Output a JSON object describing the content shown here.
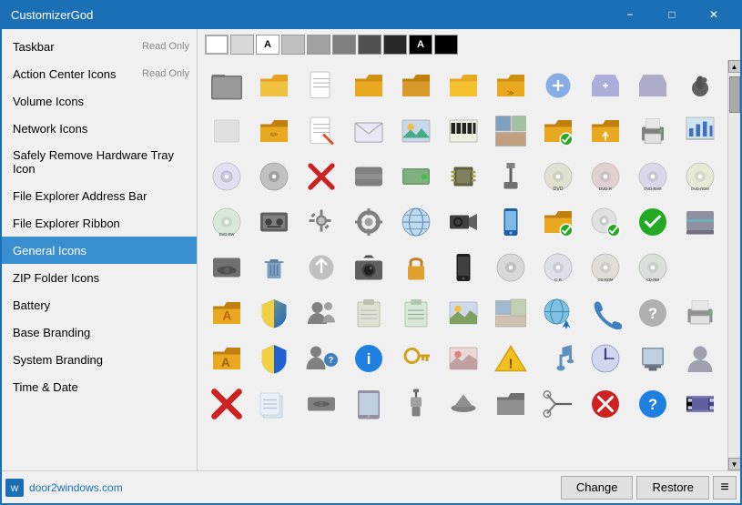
{
  "app": {
    "title": "CustomizerGod",
    "min_label": "−",
    "max_label": "□",
    "close_label": "✕"
  },
  "sidebar": {
    "items": [
      {
        "id": "taskbar",
        "label": "Taskbar",
        "badge": "Read Only"
      },
      {
        "id": "action-center",
        "label": "Action Center Icons",
        "badge": "Read Only"
      },
      {
        "id": "volume",
        "label": "Volume Icons",
        "badge": ""
      },
      {
        "id": "network",
        "label": "Network Icons",
        "badge": ""
      },
      {
        "id": "safely-remove",
        "label": "Safely Remove Hardware Tray Icon",
        "badge": ""
      },
      {
        "id": "file-explorer-addr",
        "label": "File Explorer Address Bar",
        "badge": ""
      },
      {
        "id": "file-explorer-ribbon",
        "label": "File Explorer Ribbon",
        "badge": ""
      },
      {
        "id": "general-icons",
        "label": "General Icons",
        "badge": ""
      },
      {
        "id": "zip-folder",
        "label": "ZIP Folder Icons",
        "badge": ""
      },
      {
        "id": "battery",
        "label": "Battery",
        "badge": ""
      },
      {
        "id": "base-branding",
        "label": "Base Branding",
        "badge": ""
      },
      {
        "id": "system-branding",
        "label": "System Branding",
        "badge": ""
      },
      {
        "id": "time-date",
        "label": "Time & Date",
        "badge": ""
      }
    ]
  },
  "swatches": [
    {
      "color": "#ffffff",
      "label": ""
    },
    {
      "color": "#d0d0d0",
      "label": ""
    },
    {
      "color": "#ffffff",
      "label": "A",
      "text": true
    },
    {
      "color": "#c0c0c0",
      "label": ""
    },
    {
      "color": "#b0b0b0",
      "label": ""
    },
    {
      "color": "#808080",
      "label": ""
    },
    {
      "color": "#404040",
      "label": ""
    },
    {
      "color": "#202020",
      "label": ""
    },
    {
      "color": "#000000",
      "label": "A",
      "text": true,
      "light": true
    },
    {
      "color": "#000000",
      "label": ""
    }
  ],
  "bottom": {
    "site_label": "door2windows.com",
    "change_label": "Change",
    "restore_label": "Restore",
    "menu_icon": "≡"
  }
}
